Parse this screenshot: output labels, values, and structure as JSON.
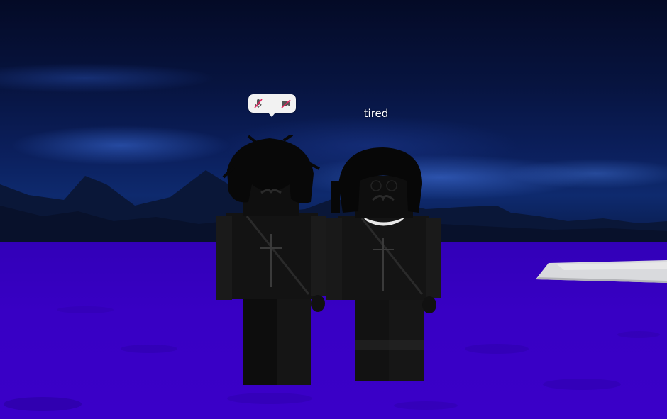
{
  "scene": {
    "sky_color": "#071440",
    "ground_color": "#3800c4",
    "plate_color": "#d8d8dc"
  },
  "overhead": {
    "voice_bubble": {
      "icons": [
        "mic-muted-icon",
        "camera-off-icon"
      ],
      "accent_color": "#e0245e"
    },
    "chat_text": "tired"
  },
  "avatars": [
    {
      "name": "avatar-left",
      "color": "#111111"
    },
    {
      "name": "avatar-right",
      "color": "#111111"
    }
  ]
}
